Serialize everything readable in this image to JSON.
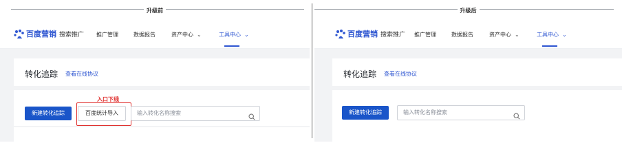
{
  "left": {
    "caption": "升级前",
    "nav": {
      "logo_text": "百度营销",
      "product": "搜索推广",
      "items": [
        "推广管理",
        "数据报告",
        "资产中心",
        "工具中心"
      ]
    },
    "title": "转化追踪",
    "link": "查看在线协议",
    "new_button": "新建转化追踪",
    "import_button": "百度统计导入",
    "search_placeholder": "输入转化名称搜索",
    "annotation": "入口下线"
  },
  "right": {
    "caption": "升级后",
    "nav": {
      "logo_text": "百度营销",
      "product": "搜索推广",
      "items": [
        "推广管理",
        "数据报告",
        "资产中心",
        "工具中心"
      ]
    },
    "title": "转化追踪",
    "link": "查看在线协议",
    "new_button": "新建转化追踪",
    "search_placeholder": "输入转化名称搜索"
  },
  "colors": {
    "accent": "#2d55d1",
    "primary_button": "#1a55c9",
    "annotation": "#e0312f"
  },
  "icons": [
    "baidu-paw-icon",
    "chevron-down-icon",
    "search-icon"
  ]
}
